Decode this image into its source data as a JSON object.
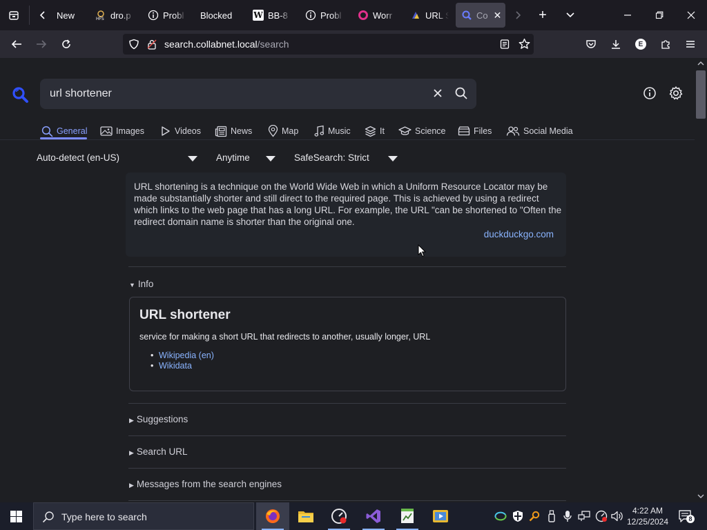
{
  "browser": {
    "tabs": [
      {
        "label": "New",
        "icon": "firefox-new-tab-icon",
        "active": false
      },
      {
        "label": "dro.p",
        "icon": "hfs-favicon-icon",
        "active": false
      },
      {
        "label": "Probl",
        "icon": "info-circle-icon",
        "active": false
      },
      {
        "label": "Blocked",
        "icon": "",
        "active": false
      },
      {
        "label": "BB-8",
        "icon": "wikipedia-icon",
        "active": false
      },
      {
        "label": "Probl",
        "icon": "info-circle-icon",
        "active": false
      },
      {
        "label": "Worr",
        "icon": "pink-ring-icon",
        "active": false
      },
      {
        "label": "URL S",
        "icon": "url-shortener-favicon-icon",
        "active": false
      },
      {
        "label": "Co",
        "icon": "search-favicon-icon",
        "active": true
      }
    ],
    "url": {
      "host": "search.collabnet.local",
      "path": "/search"
    },
    "account_initial": "E"
  },
  "search": {
    "query": "url shortener",
    "categories": [
      {
        "label": "General",
        "icon": "magnifier-icon",
        "active": true
      },
      {
        "label": "Images",
        "icon": "image-icon"
      },
      {
        "label": "Videos",
        "icon": "play-icon"
      },
      {
        "label": "News",
        "icon": "newspaper-icon"
      },
      {
        "label": "Map",
        "icon": "map-pin-icon"
      },
      {
        "label": "Music",
        "icon": "music-note-icon"
      },
      {
        "label": "It",
        "icon": "layers-icon"
      },
      {
        "label": "Science",
        "icon": "graduation-cap-icon"
      },
      {
        "label": "Files",
        "icon": "files-icon"
      },
      {
        "label": "Social Media",
        "icon": "people-icon"
      }
    ],
    "filters": {
      "language": "Auto-detect (en-US)",
      "time": "Anytime",
      "safesearch": "SafeSearch: Strict"
    }
  },
  "answer": {
    "text": "URL shortening is a technique on the World Wide Web in which a Uniform Resource Locator may be made substantially shorter and still direct to the required page. This is achieved by using a redirect which links to the web page that has a long URL. For example, the URL \"can be shortened to \"Often the redirect domain name is shorter than the original one.",
    "source": "duckduckgo.com"
  },
  "infobox": {
    "section_label": "Info",
    "title": "URL shortener",
    "description": "service for making a short URL that redirects to another, usually longer, URL",
    "links": [
      "Wikipedia (en)",
      "Wikidata"
    ]
  },
  "sections": [
    "Suggestions",
    "Search URL",
    "Messages from the search engines"
  ],
  "taskbar": {
    "search_placeholder": "Type here to search",
    "time": "4:22 AM",
    "date": "12/25/2024",
    "notification_count": "8"
  },
  "colors": {
    "accent": "#7c8cff",
    "link": "#8ab4ff",
    "page_bg": "#1e1f23"
  }
}
